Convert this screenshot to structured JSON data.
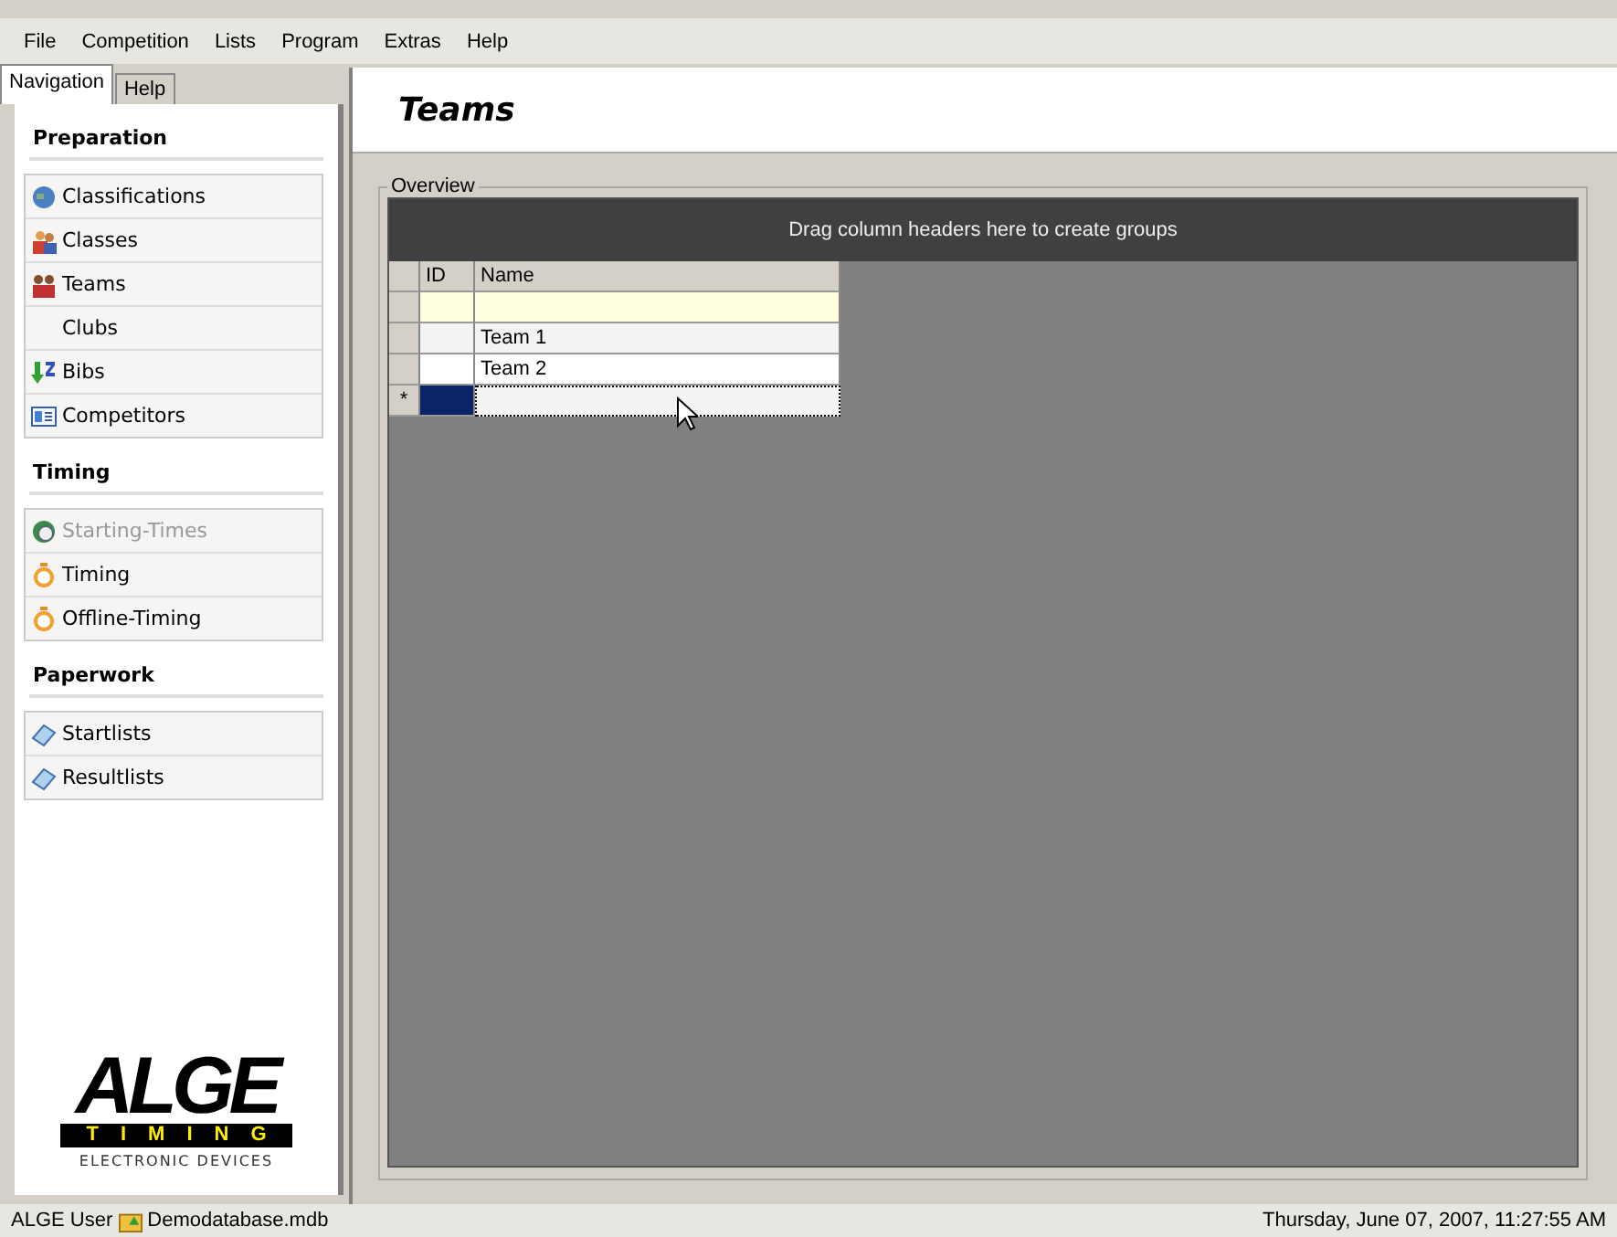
{
  "menu": [
    "File",
    "Competition",
    "Lists",
    "Program",
    "Extras",
    "Help"
  ],
  "tabs": [
    {
      "label": "Navigation",
      "selected": true
    },
    {
      "label": "Help",
      "selected": false
    }
  ],
  "sections": [
    {
      "title": "Preparation",
      "items": [
        {
          "label": "Classifications",
          "kind": "globe",
          "disabled": false
        },
        {
          "label": "Classes",
          "kind": "people",
          "disabled": false
        },
        {
          "label": "Teams",
          "kind": "group",
          "disabled": false
        },
        {
          "label": "Clubs",
          "kind": "plain",
          "disabled": false
        },
        {
          "label": "Bibs",
          "kind": "sort",
          "disabled": false
        },
        {
          "label": "Competitors",
          "kind": "card",
          "disabled": false
        }
      ]
    },
    {
      "title": "Timing",
      "items": [
        {
          "label": "Starting-Times",
          "kind": "clock",
          "disabled": true
        },
        {
          "label": "Timing",
          "kind": "stopwatch",
          "disabled": false
        },
        {
          "label": "Offline-Timing",
          "kind": "stopwatch",
          "disabled": false
        }
      ]
    },
    {
      "title": "Paperwork",
      "items": [
        {
          "label": "Startlists",
          "kind": "paper",
          "disabled": false
        },
        {
          "label": "Resultlists",
          "kind": "paper",
          "disabled": false
        }
      ]
    }
  ],
  "logo": {
    "name": "ALGE",
    "band": "TIMING",
    "tagline": "ELECTRONIC DEVICES"
  },
  "page_title": "Teams",
  "group_box": "Overview",
  "grid": {
    "group_hint": "Drag column headers here to create groups",
    "columns": [
      "ID",
      "Name"
    ],
    "rows": [
      {
        "kind": "filter",
        "selected": false
      },
      {
        "kind": "data",
        "name": "Team 1",
        "selected": false
      },
      {
        "kind": "data",
        "name": "Team 2",
        "selected": false
      },
      {
        "kind": "new",
        "marker": "*",
        "selected": true
      }
    ]
  },
  "status_bar": {
    "user": "ALGE User",
    "database": "Demodatabase.mdb",
    "datetime": "Thursday, June 07, 2007, 11:27:55 AM"
  }
}
